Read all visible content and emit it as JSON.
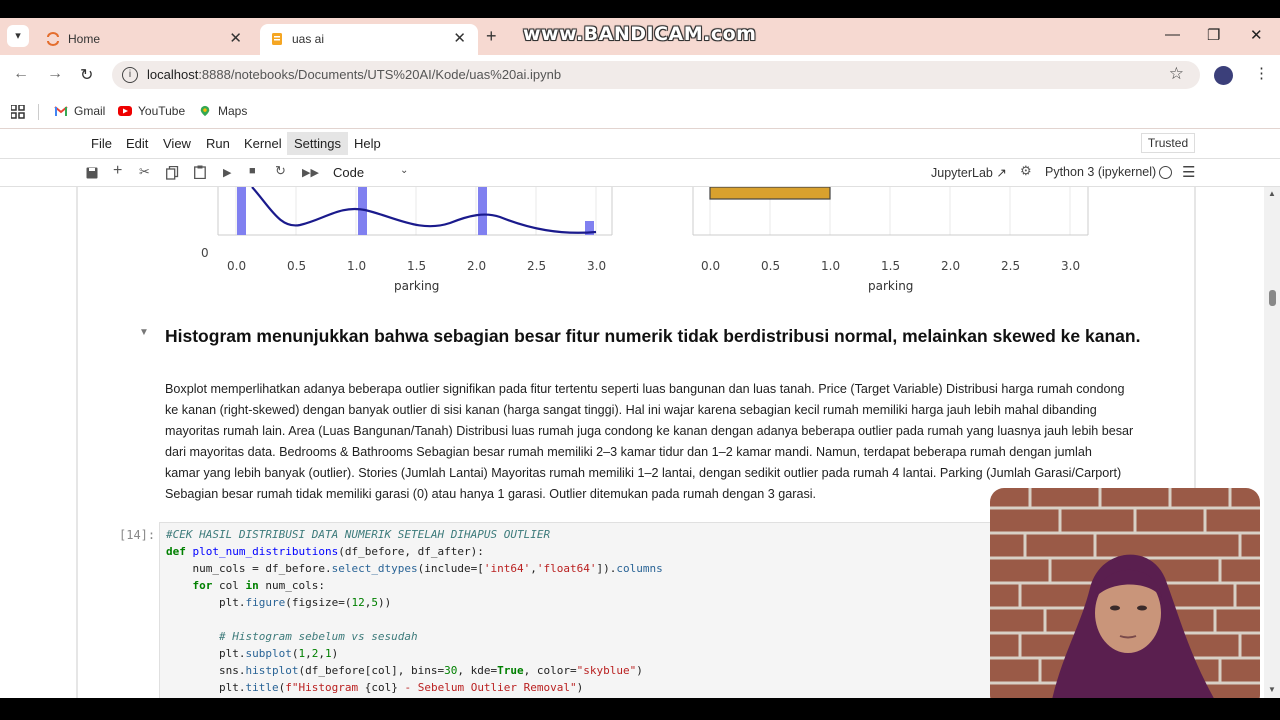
{
  "browser": {
    "tabs": [
      {
        "title": "Home",
        "active": false
      },
      {
        "title": "uas ai",
        "active": true
      }
    ],
    "new_tab_glyph": "+",
    "watermark": "www.BANDICAM.com",
    "url_host": "localhost",
    "url_rest": ":8888/notebooks/Documents/UTS%20AI/Kode/uas%20ai.ipynb",
    "bookmarks": [
      "Gmail",
      "YouTube",
      "Maps"
    ],
    "colors": {
      "tabstrip": "#f6d9d1",
      "omnibox": "#f1ebe9"
    }
  },
  "jupyter": {
    "menu": [
      "File",
      "Edit",
      "View",
      "Run",
      "Kernel",
      "Settings",
      "Help"
    ],
    "trusted": "Trusted",
    "cell_type": "Code",
    "jupyterlab_link": "JupyterLab",
    "kernel_name": "Python 3 (ipykernel)"
  },
  "output_plots": {
    "left": {
      "type": "histogram",
      "xlabel": "parking",
      "xticks": [
        "0.0",
        "0.5",
        "1.0",
        "1.5",
        "2.0",
        "2.5",
        "3.0"
      ],
      "ytick_visible": "0",
      "bars": [
        {
          "x": 0.0,
          "height_fraction": 1.0
        },
        {
          "x": 1.05,
          "height_fraction": 1.0
        },
        {
          "x": 2.05,
          "height_fraction": 1.0
        },
        {
          "x": 2.95,
          "height_fraction": 0.28
        }
      ],
      "bar_color": "#8080f0",
      "kde_color": "#1a1a8c"
    },
    "right": {
      "type": "boxplot",
      "xlabel": "parking",
      "xticks": [
        "0.0",
        "0.5",
        "1.0",
        "1.5",
        "2.0",
        "2.5",
        "3.0"
      ],
      "box_range": [
        0.0,
        1.0
      ],
      "box_color": "#d9a12e"
    }
  },
  "markdown": {
    "heading": "Histogram menunjukkan bahwa sebagian besar fitur numerik tidak berdistribusi normal, melainkan skewed ke kanan.",
    "paragraph_lines": [
      "Boxplot memperlihatkan adanya beberapa outlier signifikan pada fitur tertentu seperti luas bangunan dan luas tanah. Price (Target Variable) Distribusi harga rumah condong",
      "ke kanan (right-skewed) dengan banyak outlier di sisi kanan (harga sangat tinggi). Hal ini wajar karena sebagian kecil rumah memiliki harga jauh lebih mahal dibanding",
      "mayoritas rumah lain. Area (Luas Bangunan/Tanah) Distribusi luas rumah juga condong ke kanan dengan adanya beberapa outlier pada rumah yang luasnya jauh lebih besar",
      "dari mayoritas data. Bedrooms & Bathrooms Sebagian besar rumah memiliki 2–3 kamar tidur dan 1–2 kamar mandi. Namun, terdapat beberapa rumah dengan jumlah",
      "kamar yang lebih banyak (outlier). Stories (Jumlah Lantai) Mayoritas rumah memiliki 1–2 lantai, dengan sedikit outlier pada rumah 4 lantai. Parking (Jumlah Garasi/Carport)",
      "Sebagian besar rumah tidak memiliki garasi (0) atau hanya 1 garasi. Outlier ditemukan pada rumah dengan 3 garasi."
    ]
  },
  "code_cell": {
    "prompt": "[14]:",
    "lines": [
      "#CEK HASIL DISTRIBUSI DATA NUMERIK SETELAH DIHAPUS OUTLIER",
      "def plot_num_distributions(df_before, df_after):",
      "    num_cols = df_before.select_dtypes(include=['int64','float64']).columns",
      "    for col in num_cols:",
      "        plt.figure(figsize=(12,5))",
      "",
      "        # Histogram sebelum vs sesudah",
      "        plt.subplot(1,2,1)",
      "        sns.histplot(df_before[col], bins=30, kde=True, color=\"skyblue\")",
      "        plt.title(f\"Histogram {col} - Sebelum Outlier Removal\")"
    ]
  }
}
